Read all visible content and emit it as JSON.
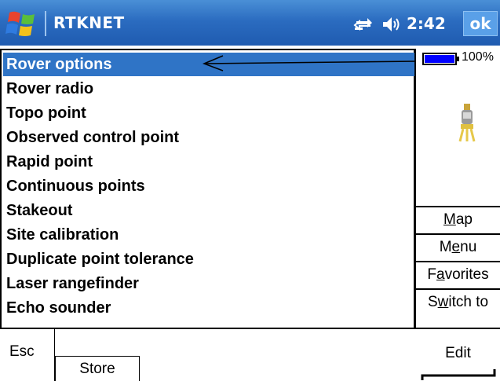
{
  "titlebar": {
    "app_title": "RTKNET",
    "clock": "2:42",
    "ok_label": "ok"
  },
  "list": {
    "items": [
      {
        "label": "Rover options",
        "selected": true
      },
      {
        "label": "Rover radio"
      },
      {
        "label": "Topo point"
      },
      {
        "label": "Observed control point"
      },
      {
        "label": "Rapid point"
      },
      {
        "label": "Continuous points"
      },
      {
        "label": "Stakeout"
      },
      {
        "label": "Site calibration"
      },
      {
        "label": "Duplicate point tolerance"
      },
      {
        "label": "Laser rangefinder"
      },
      {
        "label": "Echo sounder"
      }
    ]
  },
  "status": {
    "battery_percent": "100%",
    "battery_level": 1.0
  },
  "side_buttons": {
    "map": {
      "prefix": "",
      "underline": "M",
      "suffix": "ap"
    },
    "menu": {
      "prefix": "M",
      "underline": "e",
      "suffix": "nu"
    },
    "favorites": {
      "prefix": "F",
      "underline": "a",
      "suffix": "vorites"
    },
    "switch_to": {
      "prefix": "S",
      "underline": "w",
      "suffix": "itch to"
    }
  },
  "bottom": {
    "esc_label": "Esc",
    "store_label": "Store",
    "edit_label": "Edit"
  },
  "colors": {
    "selection": "#2f74c6",
    "titlebar": "#2b6cc0"
  },
  "icons": {
    "start": "windows-flag-icon",
    "connectivity": "connectivity-icon",
    "volume": "speaker-icon",
    "battery": "battery-icon",
    "instrument": "gps-receiver-icon"
  }
}
